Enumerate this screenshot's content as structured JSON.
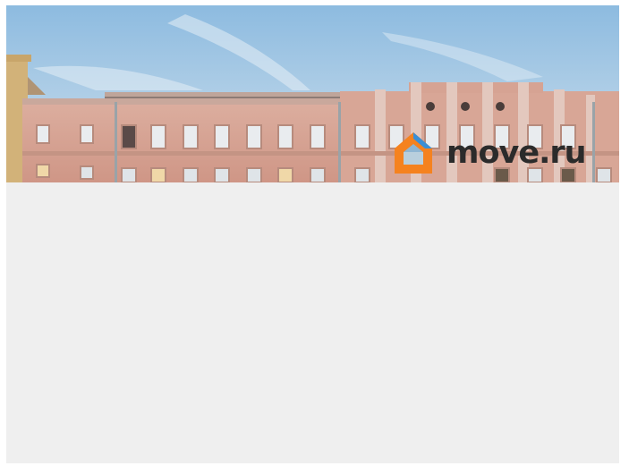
{
  "listing_photo": {
    "icon": "building-photo",
    "watermark": {
      "icon": "house-logo-icon",
      "brand_text": "move.ru",
      "colors": {
        "mark_orange": "#f5821f",
        "mark_blue": "#3a8fd6",
        "text": "#2b2b2b"
      }
    }
  },
  "colors": {
    "sky_top": "#8dbbe0",
    "sky_bottom": "#cfe0ec",
    "facade": "#d9a497",
    "placeholder_bg": "#efefef"
  }
}
